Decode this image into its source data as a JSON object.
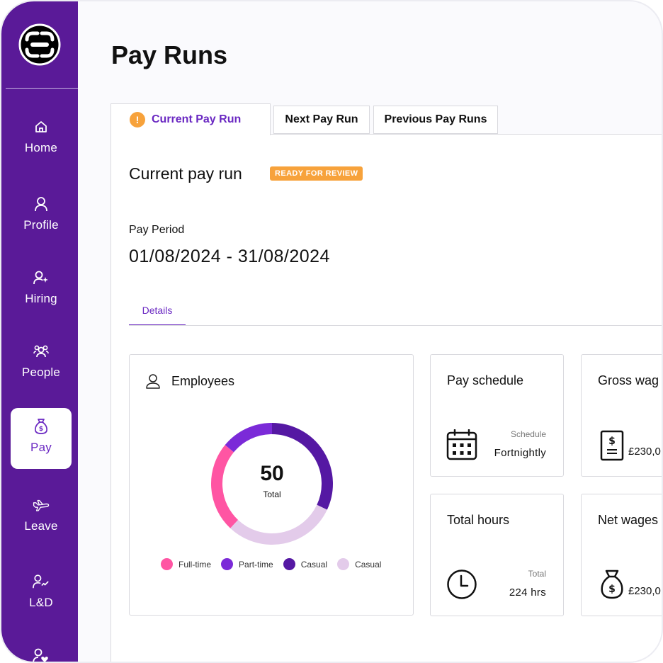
{
  "sidebar": {
    "items": [
      {
        "label": "Home",
        "icon": "home-icon"
      },
      {
        "label": "Profile",
        "icon": "user-icon"
      },
      {
        "label": "Hiring",
        "icon": "user-sparkle-icon"
      },
      {
        "label": "People",
        "icon": "people-icon"
      },
      {
        "label": "Pay",
        "icon": "money-bag-icon",
        "active": true
      },
      {
        "label": "Leave",
        "icon": "airplane-icon"
      },
      {
        "label": "L&D",
        "icon": "user-growth-icon"
      }
    ],
    "colors": {
      "background": "#5a1a98",
      "active_text": "#6a28c2"
    }
  },
  "page": {
    "title": "Pay Runs"
  },
  "tabs": [
    {
      "label": "Current Pay Run",
      "active": true,
      "icon": "warning-icon"
    },
    {
      "label": "Next Pay Run"
    },
    {
      "label": "Previous Pay Runs"
    }
  ],
  "current_run": {
    "title": "Current pay run",
    "status_badge": "READY FOR REVIEW",
    "pay_period_label": "Pay Period",
    "pay_period_value": "01/08/2024 - 31/08/2024",
    "sub_tab": "Details"
  },
  "employees_card": {
    "title": "Employees",
    "total": "50",
    "total_label": "Total",
    "chart_data": {
      "type": "pie",
      "segments": [
        {
          "label": "Full-time",
          "value": 12,
          "color": "#ff55a3"
        },
        {
          "label": "Part-time",
          "value": 7,
          "color": "#7b2ad8"
        },
        {
          "label": "Casual",
          "value": 16,
          "color": "#5518a3"
        },
        {
          "label": "Casual",
          "value": 15,
          "color": "#e3cbea"
        }
      ]
    }
  },
  "schedule_card": {
    "title": "Pay schedule",
    "meta_label": "Schedule",
    "meta_value": "Fortnightly"
  },
  "gross_card": {
    "title": "Gross wag",
    "amount": "£230,0"
  },
  "hours_card": {
    "title": "Total hours",
    "meta_label": "Total",
    "meta_value": "224 hrs"
  },
  "net_card": {
    "title": "Net wages",
    "amount": "£230,0"
  },
  "colors": {
    "accent": "#6a28c2",
    "badge": "#f7a23b"
  }
}
